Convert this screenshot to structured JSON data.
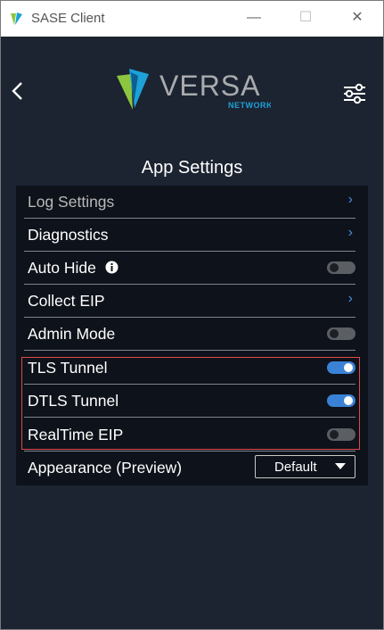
{
  "window": {
    "title": "SASE Client",
    "controls": [
      "minimize",
      "maximize",
      "close"
    ]
  },
  "header": {
    "logo_name": "VERSA",
    "logo_sub": "NETWORKS",
    "colors": {
      "logo_green": "#8cc63f",
      "logo_blue": "#1da1d8",
      "logo_text": "#a9abae",
      "logo_sub": "#1da1d8"
    }
  },
  "page_title": "App Settings",
  "settings": [
    {
      "label": "Log Settings",
      "kind": "link",
      "muted": true
    },
    {
      "label": "Diagnostics",
      "kind": "link"
    },
    {
      "label": "Auto Hide",
      "kind": "toggle",
      "on": false,
      "info": true
    },
    {
      "label": "Collect EIP",
      "kind": "link"
    },
    {
      "label": "Admin Mode",
      "kind": "toggle",
      "on": false
    },
    {
      "label": "TLS Tunnel",
      "kind": "toggle",
      "on": true
    },
    {
      "label": "DTLS Tunnel",
      "kind": "toggle",
      "on": true
    },
    {
      "label": "RealTime EIP",
      "kind": "toggle",
      "on": false
    },
    {
      "label": "Appearance (Preview)",
      "kind": "select",
      "value": "Default"
    }
  ],
  "colors": {
    "app_bg": "#1c2331",
    "panel_bg": "#0e121a",
    "accent": "#3a82d6",
    "highlight_border": "#e04a4a"
  }
}
